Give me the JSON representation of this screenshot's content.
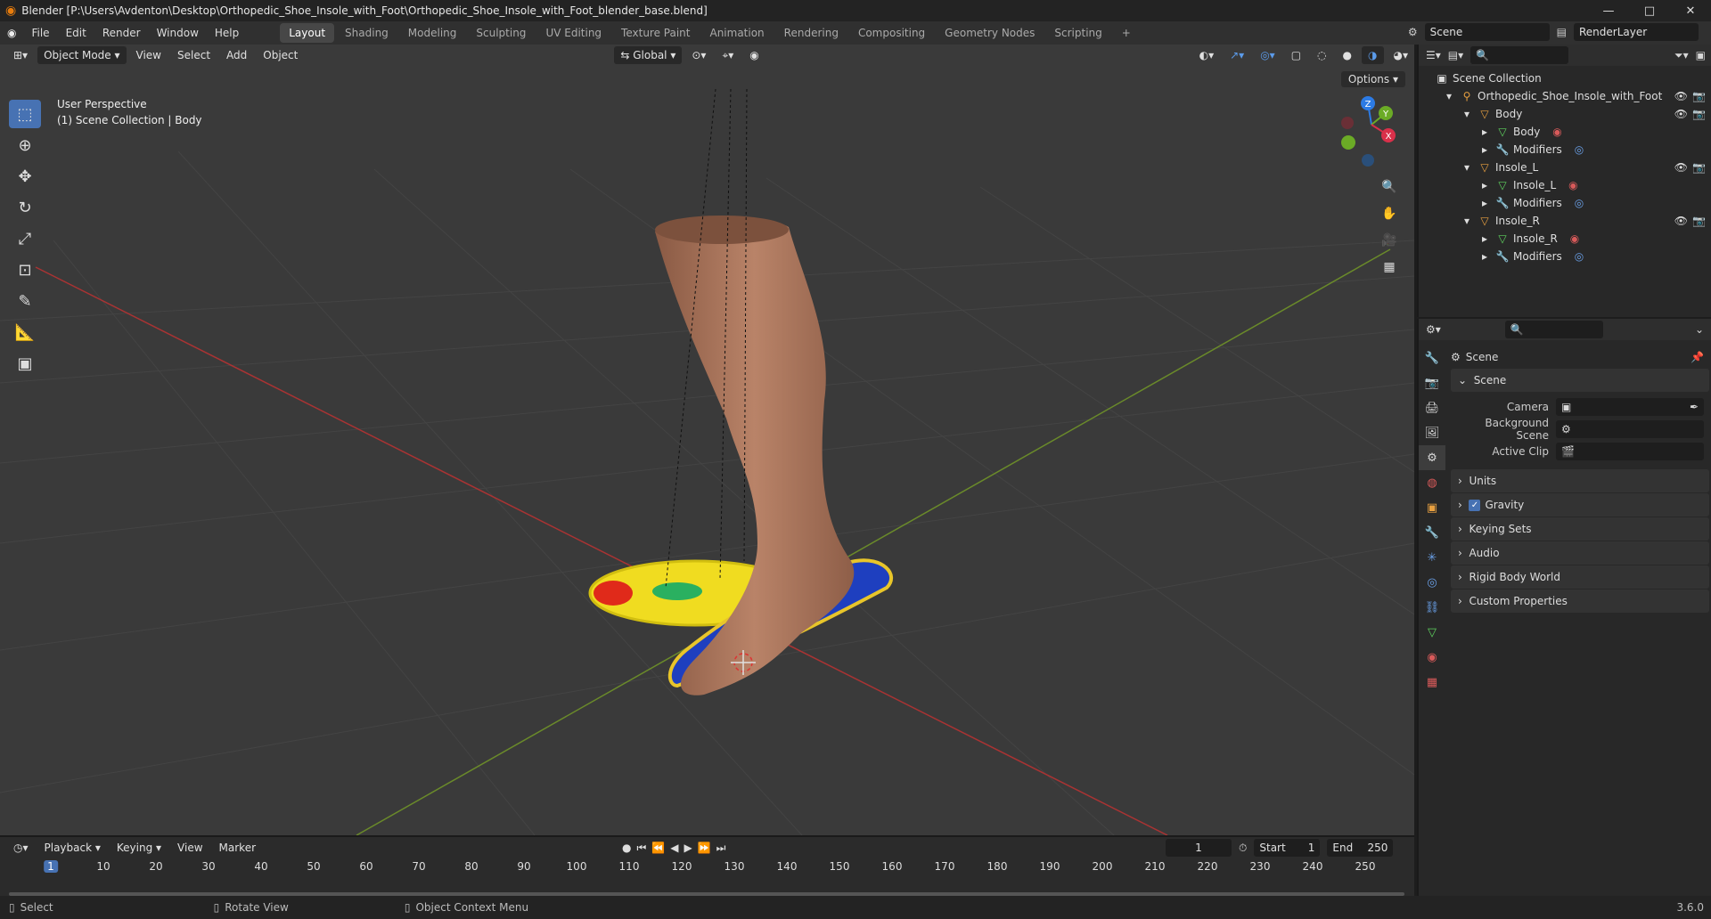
{
  "window": {
    "title": "Blender [P:\\Users\\Avdenton\\Desktop\\Orthopedic_Shoe_Insole_with_Foot\\Orthopedic_Shoe_Insole_with_Foot_blender_base.blend]",
    "minimize": "—",
    "maximize": "□",
    "close": "✕"
  },
  "menu": [
    "File",
    "Edit",
    "Render",
    "Window",
    "Help"
  ],
  "workspaces": [
    "Layout",
    "Shading",
    "Modeling",
    "Sculpting",
    "UV Editing",
    "Texture Paint",
    "Animation",
    "Rendering",
    "Compositing",
    "Geometry Nodes",
    "Scripting"
  ],
  "workspace_add": "+",
  "scene_field": "Scene",
  "view_layer_field": "RenderLayer",
  "viewport": {
    "mode": "Object Mode",
    "menus": [
      "View",
      "Select",
      "Add",
      "Object"
    ],
    "orientation": "Global",
    "options": "Options",
    "info_line1": "User Perspective",
    "info_line2": "(1) Scene Collection | Body"
  },
  "gizmo": {
    "x": "X",
    "y": "Y",
    "z": "Z"
  },
  "outliner": {
    "root": "Scene Collection",
    "items": [
      {
        "label": "Orthopedic_Shoe_Insole_with_Foot",
        "indent": 1
      },
      {
        "label": "Body",
        "indent": 2
      },
      {
        "label": "Body",
        "indent": 3
      },
      {
        "label": "Modifiers",
        "indent": 3
      },
      {
        "label": "Insole_L",
        "indent": 2
      },
      {
        "label": "Insole_L",
        "indent": 3
      },
      {
        "label": "Modifiers",
        "indent": 3
      },
      {
        "label": "Insole_R",
        "indent": 2
      },
      {
        "label": "Insole_R",
        "indent": 3
      },
      {
        "label": "Modifiers",
        "indent": 3
      }
    ]
  },
  "properties": {
    "context": "Scene",
    "panel_scene": "Scene",
    "camera_label": "Camera",
    "bg_scene_label": "Background Scene",
    "active_clip_label": "Active Clip",
    "panels": [
      "Units",
      "Gravity",
      "Keying Sets",
      "Audio",
      "Rigid Body World",
      "Custom Properties"
    ]
  },
  "timeline": {
    "menus": [
      "Playback",
      "Keying",
      "View",
      "Marker"
    ],
    "current_frame": "1",
    "start_label": "Start",
    "start": "1",
    "end_label": "End",
    "end": "250",
    "ticks": [
      "1",
      "10",
      "20",
      "30",
      "40",
      "50",
      "60",
      "70",
      "80",
      "90",
      "100",
      "110",
      "120",
      "130",
      "140",
      "150",
      "160",
      "170",
      "180",
      "190",
      "200",
      "210",
      "220",
      "230",
      "240",
      "250"
    ]
  },
  "status": {
    "select": "Select",
    "rotate": "Rotate View",
    "context_menu": "Object Context Menu",
    "version": "3.6.0"
  }
}
